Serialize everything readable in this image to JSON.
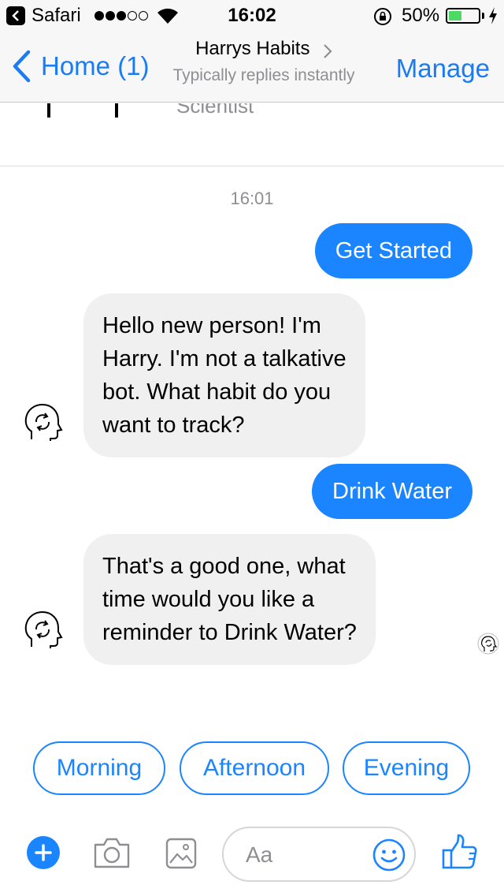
{
  "status_bar": {
    "app_name": "Safari",
    "time": "16:02",
    "battery_percent": "50%",
    "battery_level": 0.5,
    "signal_dots": [
      true,
      true,
      true,
      false,
      false
    ]
  },
  "nav": {
    "back_label": "Home (1)",
    "title": "Harrys Habits",
    "subtitle": "Typically replies instantly",
    "manage_label": "Manage"
  },
  "card_peek": {
    "text": "Scientist"
  },
  "chat": {
    "timestamp": "16:01",
    "messages": [
      {
        "from": "user",
        "text": "Get Started"
      },
      {
        "from": "bot",
        "lines": [
          "Hello new person! I'm",
          "Harry. I'm not a talkative",
          "bot. What habit do you",
          "want to track?"
        ]
      },
      {
        "from": "user",
        "text": "Drink Water"
      },
      {
        "from": "bot",
        "lines": [
          "That's a good one, what",
          "time would you like a",
          "reminder to Drink Water?"
        ]
      }
    ]
  },
  "quick_replies": [
    "Morning",
    "Afternoon",
    "Evening"
  ],
  "composer": {
    "placeholder": "Aa"
  },
  "colors": {
    "accent": "#1a85ff",
    "link": "#1a7cf3",
    "incoming_bubble": "#f1f0f0",
    "battery": "#4cd964"
  },
  "icons": {
    "avatar": "head-refresh-icon",
    "add": "plus-icon",
    "camera": "camera-icon",
    "gallery": "image-icon",
    "emoji": "smiley-icon",
    "like": "thumbs-up-icon"
  }
}
